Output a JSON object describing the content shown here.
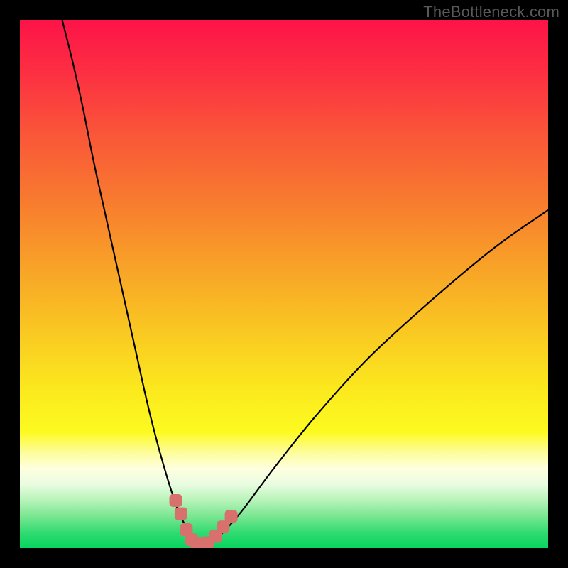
{
  "attribution": "TheBottleneck.com",
  "colors": {
    "page_bg": "#000000",
    "gradient_top": "#fd1348",
    "gradient_bottom": "#07d45f",
    "curve_stroke": "#000000",
    "marker_fill": "#d8706d",
    "attribution_text": "#595959"
  },
  "chart_data": {
    "type": "line",
    "title": "",
    "xlabel": "",
    "ylabel": "",
    "xlim": [
      0,
      100
    ],
    "ylim": [
      0,
      100
    ],
    "series": [
      {
        "name": "bottleneck-curve",
        "x": [
          8,
          10,
          12,
          14,
          16,
          18,
          20,
          22,
          24,
          26,
          28,
          30,
          32,
          33,
          34,
          35,
          36,
          38,
          42,
          48,
          56,
          66,
          78,
          90,
          100
        ],
        "y": [
          100,
          92,
          83,
          73,
          64,
          55,
          46,
          37,
          28,
          20,
          13,
          7,
          3,
          1.2,
          0.6,
          0.6,
          1.0,
          2.5,
          7,
          15,
          25,
          36,
          47,
          57,
          64
        ]
      }
    ],
    "markers": [
      {
        "x": 29.5,
        "y": 9.0
      },
      {
        "x": 30.5,
        "y": 6.5
      },
      {
        "x": 31.5,
        "y": 3.5
      },
      {
        "x": 32.5,
        "y": 1.6
      },
      {
        "x": 33.5,
        "y": 0.8
      },
      {
        "x": 34.5,
        "y": 0.7
      },
      {
        "x": 35.5,
        "y": 1.0
      },
      {
        "x": 37.0,
        "y": 2.2
      },
      {
        "x": 38.5,
        "y": 4.0
      },
      {
        "x": 40.0,
        "y": 6.0
      }
    ],
    "marker_radius": 9
  }
}
